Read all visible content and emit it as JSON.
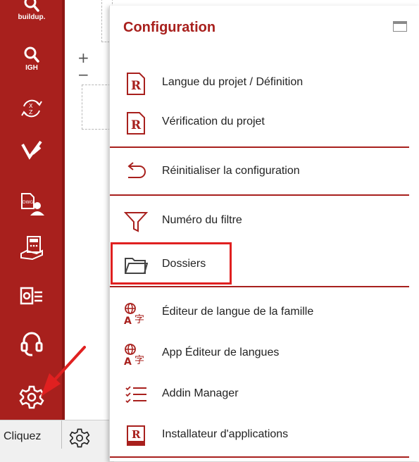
{
  "sidebar": {
    "accent": "#a8201d",
    "items": [
      {
        "icon": "search-icon",
        "label": "buildup."
      },
      {
        "icon": "search-icon",
        "label": "IGH"
      },
      {
        "icon": "axes-sync-icon",
        "label": "X Z"
      },
      {
        "icon": "edit-check-icon",
        "label": ""
      },
      {
        "icon": "dwg-user-icon",
        "label": "DWG"
      },
      {
        "icon": "calculator-hand-icon",
        "label": ""
      },
      {
        "icon": "outlook-icon",
        "label": ""
      },
      {
        "icon": "headset-icon",
        "label": ""
      },
      {
        "icon": "gear-icon",
        "label": ""
      }
    ]
  },
  "status": {
    "text": "Cliquez"
  },
  "menu": {
    "title": "Configuration",
    "highlight_color": "#e02020",
    "items": [
      {
        "icon": "revit-file-icon",
        "label": "Langue du projet / Définition"
      },
      {
        "icon": "revit-file-icon",
        "label": "Vérification du projet"
      },
      {
        "icon": "undo-arrow-icon",
        "label": "Réinitialiser la configuration"
      },
      {
        "icon": "filter-icon",
        "label": "Numéro du filtre"
      },
      {
        "icon": "folder-icon",
        "label": "Dossiers"
      },
      {
        "icon": "language-icon",
        "label": "Éditeur de langue de la famille"
      },
      {
        "icon": "language-icon",
        "label": "App Éditeur de langues"
      },
      {
        "icon": "list-icon",
        "label": "Addin Manager"
      },
      {
        "icon": "installer-icon",
        "label": "Installateur d'applications"
      }
    ]
  }
}
